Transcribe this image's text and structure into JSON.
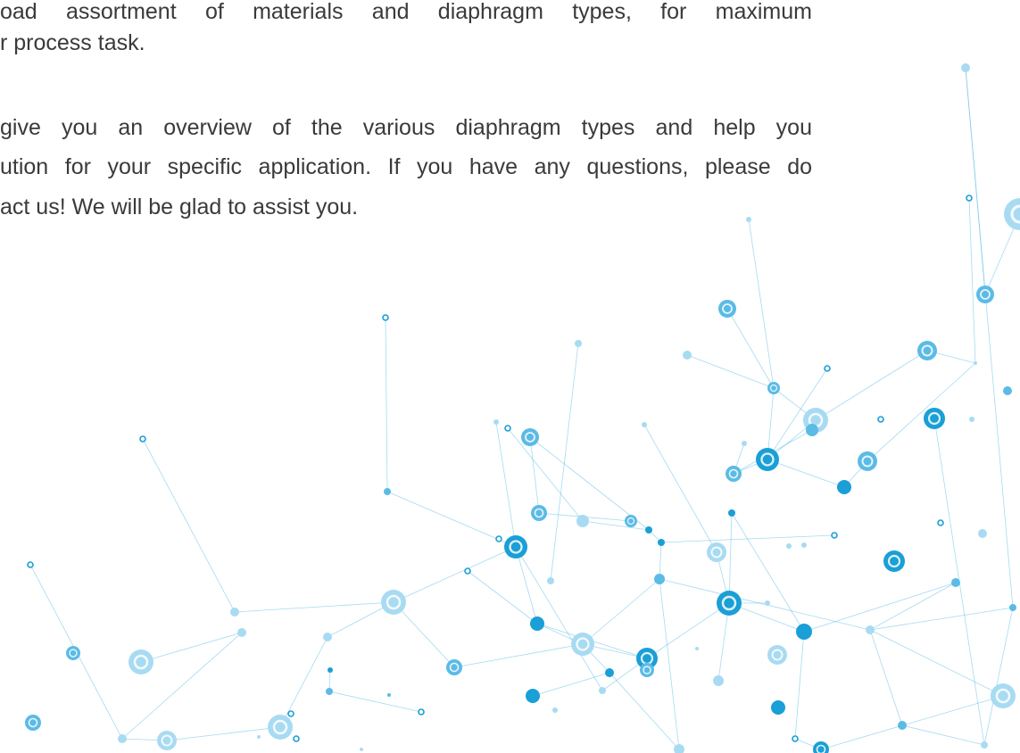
{
  "paragraphs": [
    {
      "lines": [
        {
          "text": "oad assortment of materials and diaphragm types, for maximum",
          "justified": true
        },
        {
          "text": "r process task.",
          "justified": false
        }
      ]
    },
    {
      "lines": [
        {
          "text": "give you an overview of the various diaphragm types and help you",
          "justified": true
        },
        {
          "text": "ution for your specific application. If you have any questions, please do",
          "justified": true
        },
        {
          "text": "act us!  We will be glad to assist you.",
          "justified": false
        }
      ]
    }
  ],
  "colors": {
    "text": "#3a3a3a",
    "network_dark": "#1a9fd6",
    "network_mid": "#5bbbe6",
    "network_light": "#a8dbf2"
  }
}
